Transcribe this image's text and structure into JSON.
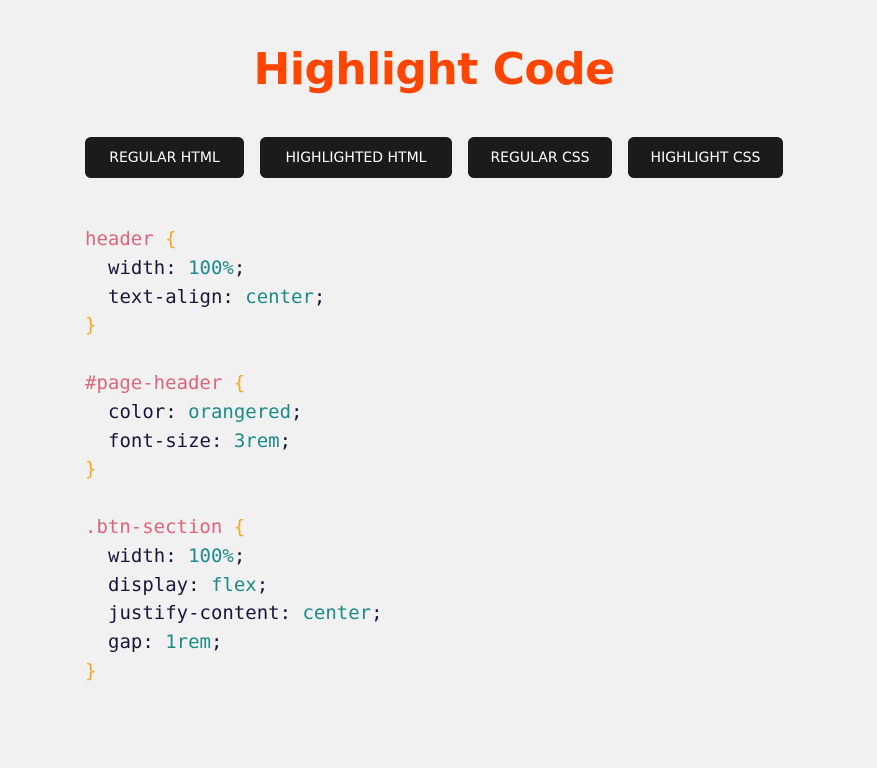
{
  "colors": {
    "background": "#f1f1f1",
    "title": "#ff4500",
    "button_bg": "#1b1b1b",
    "button_text": "#ffffff",
    "selector": "#e0647a",
    "brace": "#f5a623",
    "property": "#17153a",
    "value": "#1b8a8a"
  },
  "header": {
    "title": "Highlight Code"
  },
  "buttons": [
    {
      "label": "REGULAR HTML"
    },
    {
      "label": "HIGHLIGHTED HTML"
    },
    {
      "label": "REGULAR CSS"
    },
    {
      "label": "HIGHLIGHT CSS"
    }
  ],
  "code_rules": [
    {
      "selector": "header",
      "declarations": [
        {
          "property": "width",
          "value": "100%"
        },
        {
          "property": "text-align",
          "value": "center"
        }
      ]
    },
    {
      "selector": "#page-header",
      "declarations": [
        {
          "property": "color",
          "value": "orangered"
        },
        {
          "property": "font-size",
          "value": "3rem"
        }
      ]
    },
    {
      "selector": ".btn-section",
      "declarations": [
        {
          "property": "width",
          "value": "100%"
        },
        {
          "property": "display",
          "value": "flex"
        },
        {
          "property": "justify-content",
          "value": "center"
        },
        {
          "property": "gap",
          "value": "1rem"
        }
      ]
    }
  ],
  "syntax": {
    "open_brace": "{",
    "close_brace": "}",
    "colon": ":",
    "semicolon": ";"
  }
}
